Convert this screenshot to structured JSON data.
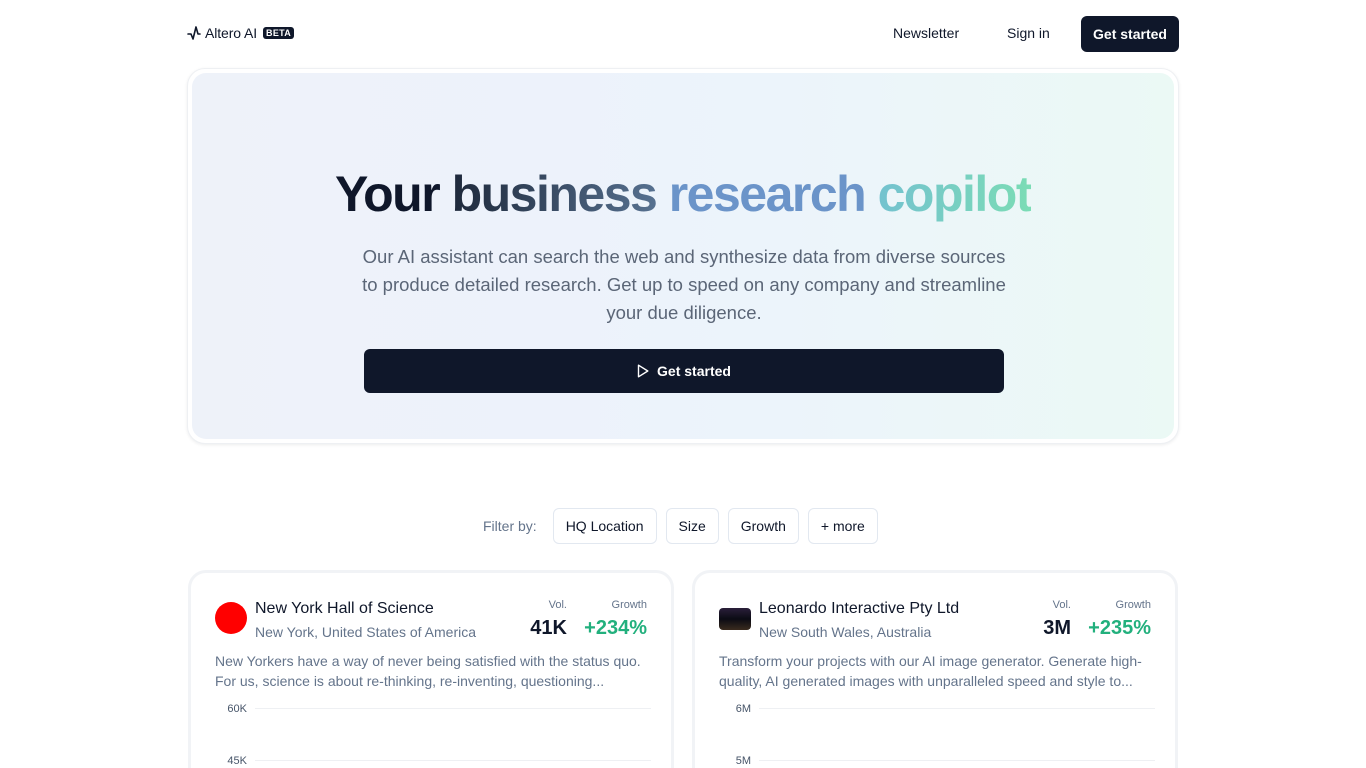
{
  "header": {
    "logo_text": "Altero AI",
    "badge": "BETA",
    "nav": {
      "newsletter": "Newsletter",
      "sign_in": "Sign in",
      "cta": "Get started"
    }
  },
  "hero": {
    "title_parts": [
      "Your ",
      "business ",
      "research ",
      "copilot"
    ],
    "subtitle": "Our AI assistant can search the web and synthesize data from diverse sources to produce detailed research. Get up to speed on any company and streamline your due diligence.",
    "cta": "Get started",
    "cta_icon": "play-icon"
  },
  "filters": {
    "label": "Filter by:",
    "chips": [
      "HQ Location",
      "Size",
      "Growth",
      "+ more"
    ]
  },
  "cards": [
    {
      "name": "New York Hall of Science",
      "location": "New York, United States of America",
      "vol_label": "Vol.",
      "growth_label": "Growth",
      "vol": "41K",
      "growth": "+234%",
      "description": "New Yorkers have a way of never being satisfied with the status quo. For us, science is about re-thinking, re-inventing, questioning...",
      "chart_ticks": [
        "60K",
        "45K"
      ]
    },
    {
      "name": "Leonardo Interactive Pty Ltd",
      "location": "New South Wales, Australia",
      "vol_label": "Vol.",
      "growth_label": "Growth",
      "vol": "3M",
      "growth": "+235%",
      "description": "Transform your projects with our AI image generator. Generate high-quality, AI generated images with unparalleled speed and style to...",
      "chart_ticks": [
        "6M",
        "5M"
      ]
    }
  ],
  "colors": {
    "primary": "#0f172a",
    "muted": "#64748b",
    "growth": "#22b07d",
    "gradient_blue": "#6b94c9",
    "gradient_teal": "#7bdcb5"
  }
}
